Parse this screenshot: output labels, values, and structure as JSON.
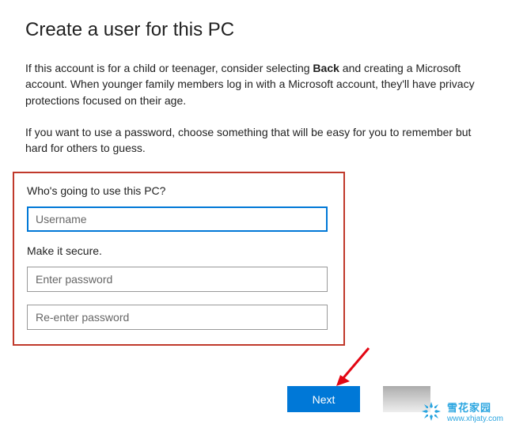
{
  "title": "Create a user for this PC",
  "intro1_a": "If this account is for a child or teenager, consider selecting ",
  "intro1_bold": "Back",
  "intro1_b": " and creating a Microsoft account. When younger family members log in with a Microsoft account, they'll have privacy protections focused on their age.",
  "intro2": "If you want to use a password, choose something that will be easy for you to remember but hard for others to guess.",
  "form": {
    "who_label": "Who's going to use this PC?",
    "username_placeholder": "Username",
    "secure_label": "Make it secure.",
    "password_placeholder": "Enter password",
    "reenter_placeholder": "Re-enter password"
  },
  "next_label": "Next",
  "watermark": {
    "cn": "雪花家园",
    "url": "www.xhjaty.com"
  }
}
